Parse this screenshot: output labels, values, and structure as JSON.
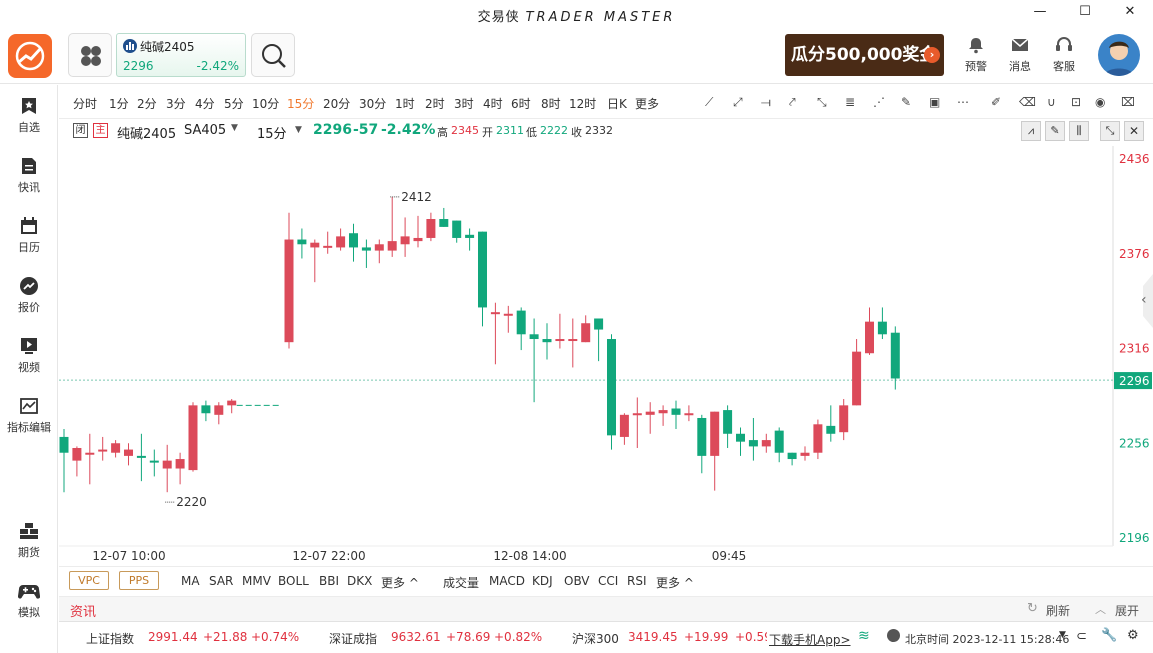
{
  "window": {
    "title_cn": "交易侠",
    "title_en": "TRADER MASTER"
  },
  "header": {
    "quote_card": {
      "name": "纯碱2405",
      "price": "2296",
      "change_pct": "-2.42%"
    },
    "promo": "瓜分500,000奖金",
    "actions": [
      {
        "label": "预警"
      },
      {
        "label": "消息"
      },
      {
        "label": "客服"
      }
    ]
  },
  "sidebar": {
    "top": [
      {
        "label": "自选"
      },
      {
        "label": "快讯"
      },
      {
        "label": "日历"
      },
      {
        "label": "报价"
      },
      {
        "label": "视频"
      },
      {
        "label": "指标编辑"
      }
    ],
    "bottom": [
      {
        "label": "期货"
      },
      {
        "label": "模拟"
      }
    ]
  },
  "periods": [
    "分时",
    "1分",
    "2分",
    "3分",
    "4分",
    "5分",
    "10分",
    "15分",
    "20分",
    "30分",
    "1时",
    "2时",
    "3时",
    "4时",
    "6时",
    "8时",
    "12时",
    "日K",
    "更多"
  ],
  "active_period": "15分",
  "infobar": {
    "badge1": "闭",
    "badge2": "主",
    "name": "纯碱2405",
    "code": "SA405",
    "period": "15分",
    "price": "2296",
    "change": "-57",
    "change_pct": "-2.42%",
    "high_label": "高",
    "high": "2345",
    "open_label": "开",
    "open": "2311",
    "low_label": "低",
    "low": "2222",
    "close_label": "收",
    "close": "2332"
  },
  "chart_data": {
    "type": "candlestick",
    "y_ticks": [
      "2436",
      "2376",
      "2316",
      "2256",
      "2196"
    ],
    "current_price_label": "2296",
    "x_ticks": [
      "12-07 10:00",
      "12-07 22:00",
      "12-08 14:00",
      "09:45"
    ],
    "annotations": {
      "high": "2412",
      "low": "2220"
    },
    "candles": [
      [
        2260,
        2250,
        2265,
        2225
      ],
      [
        2245,
        2253,
        2254,
        2235
      ],
      [
        2249,
        2250,
        2262,
        2230
      ],
      [
        2252,
        2252,
        2260,
        2245
      ],
      [
        2250,
        2256,
        2258,
        2247
      ],
      [
        2248,
        2252,
        2256,
        2242
      ],
      [
        2248,
        2247,
        2262,
        2232
      ],
      [
        2245,
        2244,
        2252,
        2235
      ],
      [
        2240,
        2245,
        2255,
        2225
      ],
      [
        2240,
        2246,
        2250,
        2230
      ],
      [
        2239,
        2280,
        2282,
        2238
      ],
      [
        2280,
        2275,
        2283,
        2270
      ],
      [
        2274,
        2280,
        2282,
        2268
      ],
      [
        2280,
        2283,
        2284,
        2275
      ],
      [
        2320,
        2385,
        2402,
        2316
      ],
      [
        2385,
        2382,
        2392,
        2373
      ],
      [
        2380,
        2383,
        2385,
        2358
      ],
      [
        2380,
        2381,
        2390,
        2376
      ],
      [
        2380,
        2387,
        2392,
        2378
      ],
      [
        2389,
        2380,
        2395,
        2371
      ],
      [
        2380,
        2378,
        2385,
        2367
      ],
      [
        2378,
        2382,
        2385,
        2370
      ],
      [
        2378,
        2384,
        2412,
        2374
      ],
      [
        2382,
        2387,
        2399,
        2374
      ],
      [
        2384,
        2386,
        2400,
        2380
      ],
      [
        2386,
        2398,
        2402,
        2384
      ],
      [
        2398,
        2393,
        2405,
        2393
      ],
      [
        2397,
        2386,
        2397,
        2383
      ],
      [
        2388,
        2386,
        2392,
        2378
      ],
      [
        2390,
        2342,
        2390,
        2330
      ],
      [
        2338,
        2339,
        2345,
        2306
      ],
      [
        2338,
        2338,
        2343,
        2326
      ],
      [
        2340,
        2325,
        2342,
        2315
      ],
      [
        2325,
        2322,
        2335,
        2282
      ],
      [
        2322,
        2320,
        2332,
        2309
      ],
      [
        2321,
        2322,
        2338,
        2316
      ],
      [
        2322,
        2322,
        2335,
        2304
      ],
      [
        2320,
        2332,
        2337,
        2320
      ],
      [
        2335,
        2328,
        2335,
        2308
      ],
      [
        2322,
        2261,
        2325,
        2252
      ],
      [
        2260,
        2274,
        2275,
        2255
      ],
      [
        2274,
        2275,
        2285,
        2253
      ],
      [
        2274,
        2276,
        2282,
        2262
      ],
      [
        2275,
        2277,
        2280,
        2267
      ],
      [
        2278,
        2274,
        2283,
        2265
      ],
      [
        2275,
        2275,
        2280,
        2270
      ],
      [
        2272,
        2248,
        2274,
        2237
      ],
      [
        2248,
        2276,
        2276,
        2226
      ],
      [
        2277,
        2262,
        2280,
        2253
      ],
      [
        2262,
        2257,
        2266,
        2248
      ],
      [
        2258,
        2254,
        2272,
        2245
      ],
      [
        2254,
        2258,
        2262,
        2250
      ],
      [
        2264,
        2250,
        2266,
        2244
      ],
      [
        2250,
        2246,
        2250,
        2242
      ],
      [
        2248,
        2250,
        2254,
        2245
      ],
      [
        2250,
        2268,
        2271,
        2246
      ],
      [
        2267,
        2262,
        2280,
        2257
      ],
      [
        2263,
        2280,
        2284,
        2258
      ],
      [
        2280,
        2314,
        2322,
        2280
      ],
      [
        2313,
        2333,
        2342,
        2312
      ],
      [
        2333,
        2325,
        2342,
        2322
      ],
      [
        2326,
        2297,
        2330,
        2290
      ]
    ]
  },
  "indicators": {
    "buttons": [
      "VPC",
      "PPS"
    ],
    "main": [
      "MA",
      "SAR",
      "MMV",
      "BOLL",
      "BBI",
      "DKX",
      "更多 ^"
    ],
    "sub": [
      "成交量",
      "MACD",
      "KDJ",
      "OBV",
      "CCI",
      "RSI",
      "更多 ^"
    ]
  },
  "news": {
    "title": "资讯",
    "refresh": "刷新",
    "expand": "展开"
  },
  "status": {
    "indices": [
      {
        "name": "上证指数",
        "price": "2991.44",
        "change": "+21.88",
        "pct": "+0.74%"
      },
      {
        "name": "深证成指",
        "price": "9632.61",
        "change": "+78.69",
        "pct": "+0.82%"
      },
      {
        "name": "沪深300",
        "price": "3419.45",
        "change": "+19.99",
        "pct": "+0.59%"
      }
    ],
    "app_link": "下载手机App>",
    "time": "北京时间 2023-12-11 15:28:46"
  }
}
